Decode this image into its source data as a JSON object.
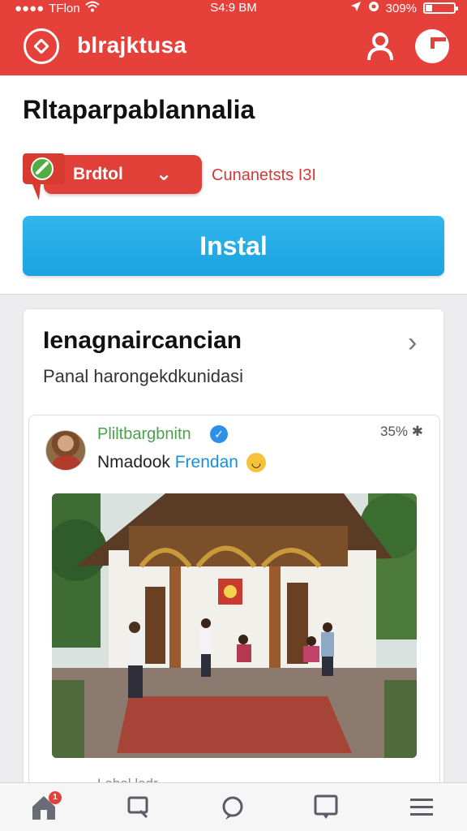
{
  "status_bar": {
    "carrier": "TFlon",
    "time": "S4:9 BM",
    "battery": "309%"
  },
  "app": {
    "brand": "blrajktusa"
  },
  "header": {
    "title": "Rltaparpablannalia",
    "dropdown_label": "Brdtol",
    "channel_text": "Cunanetsts I3I",
    "install_label": "Instal"
  },
  "card": {
    "title": "Ienagnaircancian",
    "subtitle": "Panal harongekdkunidasi",
    "post": {
      "author": "Pliltbargbnitn",
      "stat": "35% ✱",
      "text_prefix": "Nmadook",
      "text_link": "Frendan",
      "footer": "Labal ladr"
    }
  },
  "tabbar": {
    "items": [
      "home",
      "search",
      "chat",
      "messages",
      "menu"
    ],
    "home_badge": "1"
  }
}
